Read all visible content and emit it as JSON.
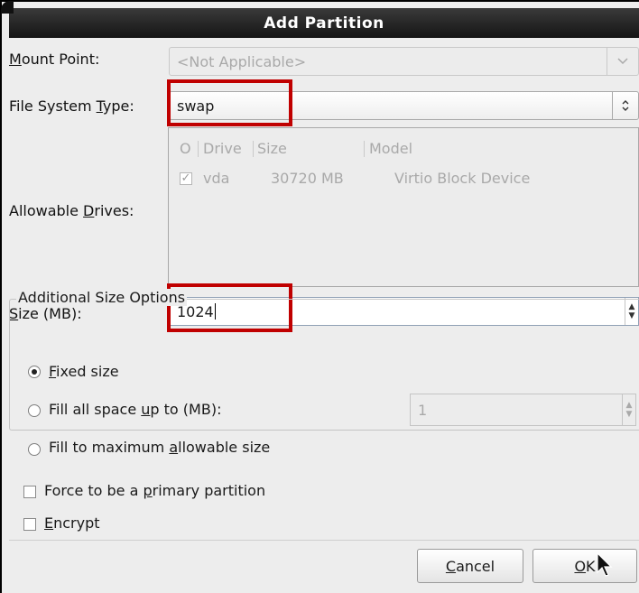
{
  "dialog": {
    "title": "Add Partition"
  },
  "mount_point": {
    "label_pre": "",
    "label_key": "M",
    "label_post": "ount Point:",
    "value": "<Not Applicable>",
    "icon": "chevron-down-icon"
  },
  "fs_type": {
    "label_pre": "File System ",
    "label_key": "T",
    "label_post": "ype:",
    "value": "swap",
    "icon": "up-down-chevron-icon"
  },
  "drives": {
    "label_pre": "Allowable ",
    "label_key": "D",
    "label_post": "rives:",
    "columns": [
      "O",
      "Drive",
      "Size",
      "Model"
    ],
    "rows": [
      {
        "checked": true,
        "check_glyph": "✓",
        "drive": "vda",
        "size": "30720 MB",
        "model": "Virtio Block Device"
      }
    ]
  },
  "size": {
    "label_pre": "",
    "label_key": "S",
    "label_post": "ize (MB):",
    "value": "1024"
  },
  "additional": {
    "legend": "Additional Size Options",
    "fixed": {
      "pre": "",
      "key": "F",
      "post": "ixed size",
      "selected": true
    },
    "fill_upto": {
      "pre": "Fill all space ",
      "key": "u",
      "post": "p to (MB):",
      "selected": false,
      "value": "1"
    },
    "fill_max": {
      "pre": "Fill to maximum ",
      "key": "a",
      "post": "llowable size",
      "selected": false
    }
  },
  "force_primary": {
    "pre": "Force to be a ",
    "key": "p",
    "post": "rimary partition",
    "checked": false
  },
  "encrypt": {
    "pre": "",
    "key": "E",
    "post": "ncrypt",
    "checked": false
  },
  "buttons": {
    "cancel": {
      "pre": "",
      "key": "C",
      "post": "ancel"
    },
    "ok": {
      "pre": "",
      "key": "O",
      "post": "K"
    }
  },
  "colors": {
    "highlight": "#c00000",
    "titlebar": "#1e1e1e"
  }
}
